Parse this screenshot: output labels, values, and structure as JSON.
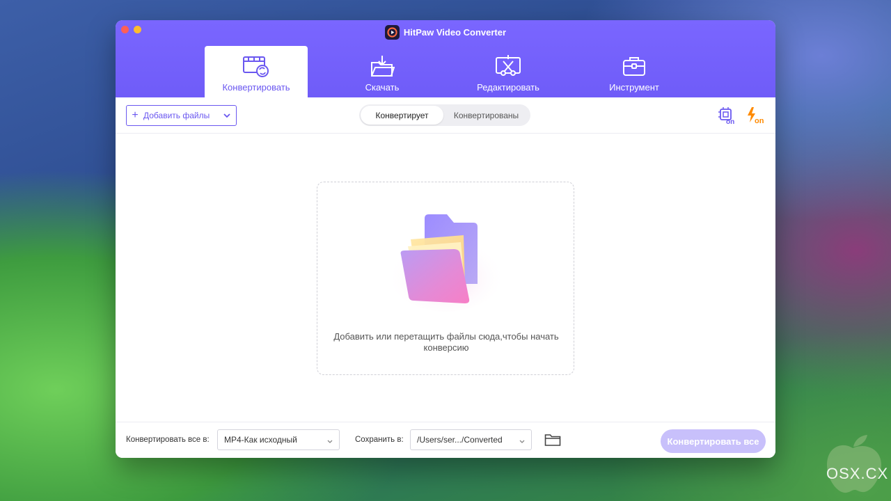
{
  "app": {
    "title": "HitPaw Video Converter"
  },
  "tabs": [
    {
      "label": "Конвертировать",
      "icon": "film-convert-icon",
      "active": true
    },
    {
      "label": "Скачать",
      "icon": "download-folder-icon",
      "active": false
    },
    {
      "label": "Редактировать",
      "icon": "edit-scissors-icon",
      "active": false
    },
    {
      "label": "Инструмент",
      "icon": "toolbox-icon",
      "active": false
    }
  ],
  "toolbar": {
    "add_files": "Добавить файлы",
    "segment": {
      "converting": "Конвертирует",
      "converted": "Конвертированы"
    },
    "hw_accel_label": "on",
    "lightning_label": "on"
  },
  "dropzone": {
    "text": "Добавить или перетащить файлы сюда,чтобы начать конверсию"
  },
  "bottom": {
    "convert_all_to_label": "Конвертировать все в:",
    "format_value": "MP4-Как исходный",
    "save_to_label": "Сохранить в:",
    "path_value": "/Users/ser.../Converted",
    "convert_all_button": "Конвертировать все"
  },
  "watermark": {
    "text": "OSX.CX"
  },
  "colors": {
    "accent": "#6a57f0",
    "header": "#7a66ff",
    "lightning": "#ff8a00",
    "disabled_button": "#c8c0fb"
  }
}
